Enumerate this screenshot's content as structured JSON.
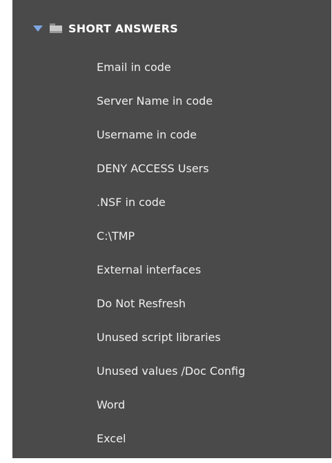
{
  "folder": {
    "title": "SHORT ANSWERS",
    "expanded": true,
    "triangle_color": "#7fa6e0",
    "icon": "folder-icon"
  },
  "items": [
    {
      "label": "Email in code"
    },
    {
      "label": "Server Name in code"
    },
    {
      "label": "Username in code"
    },
    {
      "label": "DENY ACCESS Users"
    },
    {
      "label": ".NSF in code"
    },
    {
      "label": "C:\\TMP"
    },
    {
      "label": "External interfaces"
    },
    {
      "label": "Do Not Resfresh"
    },
    {
      "label": "Unused script libraries"
    },
    {
      "label": "Unused values /Doc Config"
    },
    {
      "label": "Word"
    },
    {
      "label": "Excel"
    }
  ],
  "colors": {
    "panel_background": "#4a4a4a",
    "text": "#f0f0f0"
  }
}
